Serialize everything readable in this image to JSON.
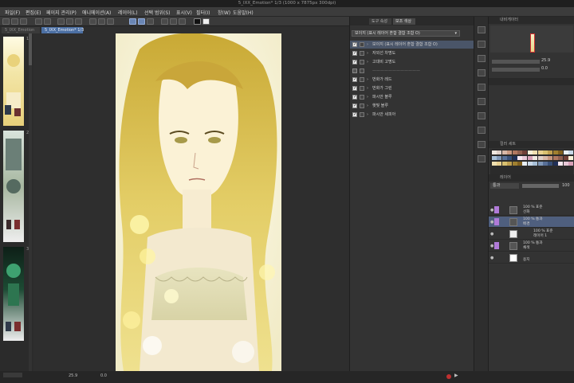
{
  "window": {
    "title": "5_IXX_Emotion* 1/3 (1000 x 7875px 300dpi)"
  },
  "menu": [
    "파일(F)",
    "편집(E)",
    "페이지 관리(P)",
    "애니메이션(A)",
    "레이어(L)",
    "선택 범위(S)",
    "표시(V)",
    "필터(I)",
    "창(W)",
    "도움말(H)"
  ],
  "tabs": {
    "inactive": "5_IXX_Emotion",
    "active": "5_IXX_Emotion* 1/3"
  },
  "page_numbers": [
    "1a",
    "2",
    "3"
  ],
  "panel": {
    "tabs": [
      "도구 속성",
      "보조 색상"
    ],
    "dropdown": "보이지 (표시 레이어 혼합 결합 조합 O)",
    "rows": [
      {
        "label": "보이지 (표시 레이어 혼합 결합 조합 O)",
        "checked": true,
        "highlight": true
      },
      {
        "label": "자외선 차명도",
        "checked": true
      },
      {
        "label": "고대비 고명도",
        "checked": true
      },
      {
        "label": "————————————",
        "checked": false,
        "separator": true
      },
      {
        "label": "번화가 레드",
        "checked": true
      },
      {
        "label": "번화가 그린",
        "checked": true
      },
      {
        "label": "파시안 블루",
        "checked": true
      },
      {
        "label": "햇빛 블루",
        "checked": true
      },
      {
        "label": "파시안 세피아",
        "checked": true
      }
    ]
  },
  "right": {
    "navigator_header": "내비게이터",
    "zoom": "25.9",
    "rotation": "0.0",
    "palette_header": "컬러 세트",
    "layers_header": "레이어",
    "blend_mode": "통과",
    "opacity": "100",
    "layers": [
      {
        "mode": "100 % 표준",
        "name": "선화",
        "highlight": false
      },
      {
        "mode": "100 % 통과",
        "name": "배경",
        "highlight": true
      },
      {
        "mode": "100 % 표준",
        "name": "레이어 1",
        "highlight": false
      },
      {
        "mode": "100 % 통과",
        "name": "채색",
        "highlight": false
      },
      {
        "mode": "",
        "name": "용지",
        "highlight": false
      }
    ]
  },
  "status": {
    "zoom": "25.9",
    "rotation": "0.0"
  },
  "colors": {
    "accent": "#4b6fa3",
    "layer_purple": "#b07ad8",
    "nav_frame": "#d03030"
  }
}
